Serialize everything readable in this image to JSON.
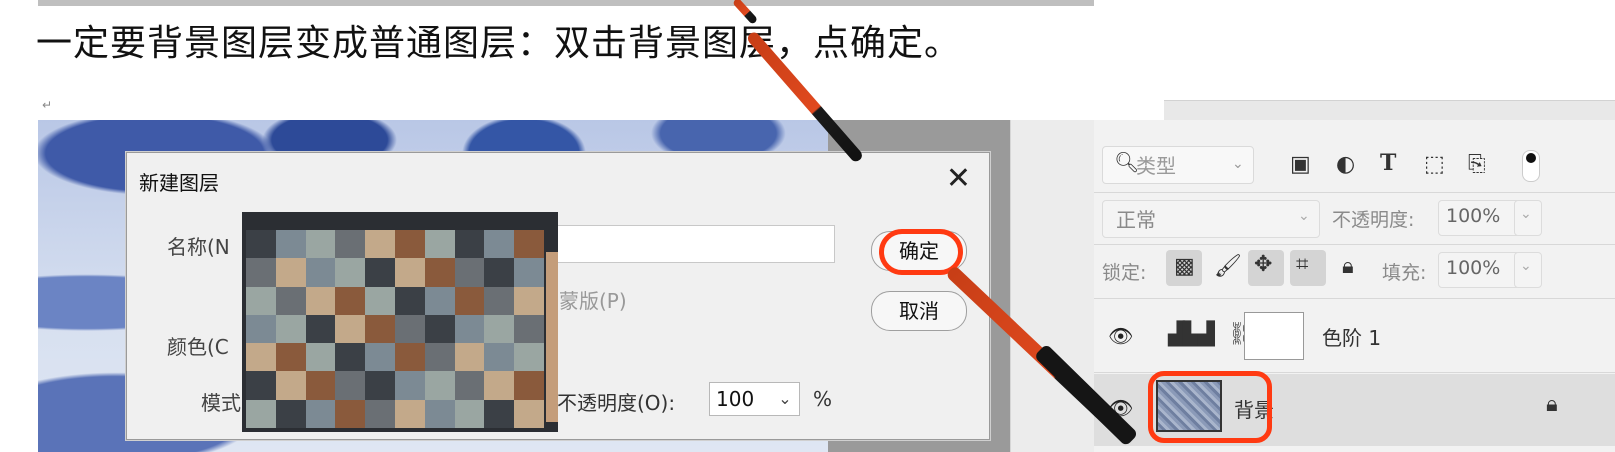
{
  "document": {
    "instruction": "一定要背景图层变成普通图层：双击背景图层，点确定。",
    "paragraph_mark": "↵"
  },
  "dialog": {
    "title": "新建图层",
    "name_label": "名称(N",
    "mask_option": "蒙版(P)",
    "color_label": "颜色(C",
    "mode_label": "模式",
    "opacity_label": "不透明度(O):",
    "opacity_value": "100",
    "percent": "%",
    "ok_label": "确定",
    "cancel_label": "取消"
  },
  "layers_panel": {
    "filter_placeholder": "类型",
    "blend_mode": "正常",
    "opacity_label": "不透明度:",
    "opacity_value": "100%",
    "lock_label": "锁定:",
    "fill_label": "填充:",
    "fill_value": "100%",
    "layers": [
      {
        "name": "色阶 1",
        "type": "adjustment"
      },
      {
        "name": "背景",
        "type": "background",
        "locked": true
      }
    ]
  },
  "colors": {
    "highlight": "#ff3a12",
    "pen_orange": "#e0491f"
  }
}
